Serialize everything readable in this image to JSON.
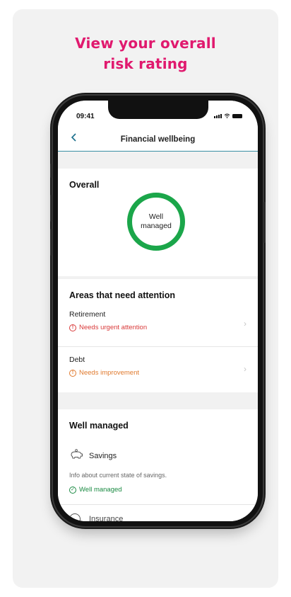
{
  "headline": {
    "line1": "View your overall",
    "line2": "risk rating"
  },
  "statusbar": {
    "time": "09:41"
  },
  "nav": {
    "title": "Financial wellbeing",
    "back_icon": "chevron-left-icon"
  },
  "overall": {
    "title": "Overall",
    "rating_label": "Well managed",
    "ring_color": "#1ba64a"
  },
  "attention": {
    "title": "Areas that need attention",
    "items": [
      {
        "name": "Retirement",
        "status": "Needs urgent attention",
        "status_color": "#d93a3a",
        "icon": "alert-circle-icon"
      },
      {
        "name": "Debt",
        "status": "Needs improvement",
        "status_color": "#e07a2e",
        "icon": "alert-circle-icon"
      }
    ]
  },
  "well_managed": {
    "title": "Well managed",
    "savings": {
      "name": "Savings",
      "icon": "piggy-bank-icon",
      "info": "Info about current state of savings.",
      "status": "Well managed",
      "status_color": "#1a8a42"
    },
    "next_item": {
      "name": "Insurance",
      "icon": "umbrella-icon"
    }
  },
  "colors": {
    "brand_pink": "#e0196e",
    "nav_accent": "#3a8fa3"
  }
}
